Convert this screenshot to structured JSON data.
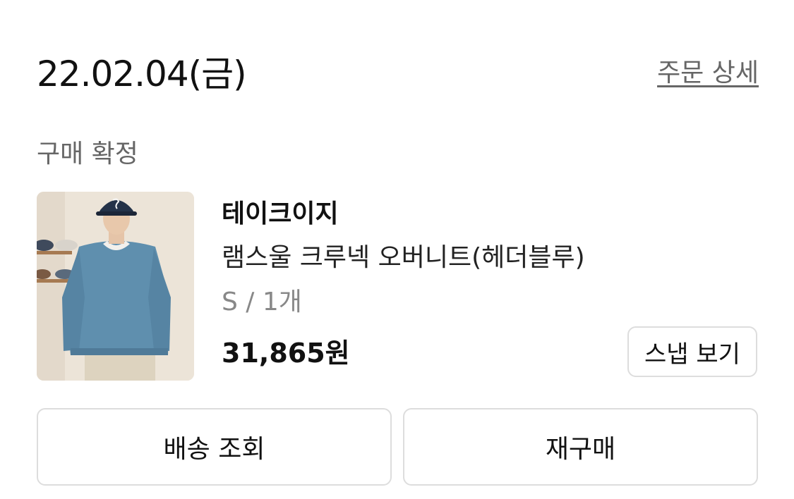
{
  "order": {
    "date": "22.02.04(금)",
    "detail_link_label": "주문 상세",
    "status": "구매 확정"
  },
  "product": {
    "brand": "테이크이지",
    "name": "램스울 크루넥 오버니트(헤더블루)",
    "option": "S / 1개",
    "price": "31,865원",
    "snap_button_label": "스냅 보기",
    "image_alt": "램스울 크루넥 오버니트(헤더블루)"
  },
  "actions": {
    "track_delivery_label": "배송 조회",
    "reorder_label": "재구매"
  },
  "colors": {
    "sweater": "#5f8fae",
    "background": "#ece4d8",
    "border": "#dddddd",
    "muted_text": "#666666"
  }
}
